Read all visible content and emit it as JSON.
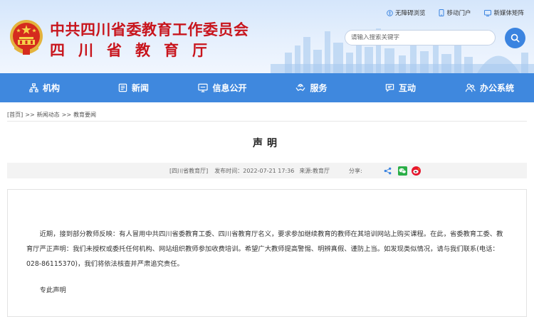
{
  "header": {
    "title_cn": "中共四川省委教育工作委员会",
    "title_sub": "四川省教育厅",
    "top_links": [
      {
        "label": "无障碍浏览",
        "icon": "accessibility-icon"
      },
      {
        "label": "移动门户",
        "icon": "mobile-icon"
      },
      {
        "label": "新媒体矩阵",
        "icon": "media-matrix-icon"
      }
    ],
    "search": {
      "placeholder": "请输入搜索关键字",
      "value": ""
    },
    "colors": {
      "title": "#c8151d",
      "nav": "#3f88de",
      "accent": "#3b84e0"
    }
  },
  "nav": [
    {
      "label": "机构",
      "icon": "org-icon"
    },
    {
      "label": "新闻",
      "icon": "news-icon"
    },
    {
      "label": "信息公开",
      "icon": "info-open-icon"
    },
    {
      "label": "服务",
      "icon": "service-icon"
    },
    {
      "label": "互动",
      "icon": "interaction-icon"
    },
    {
      "label": "办公系统",
      "icon": "office-system-icon"
    }
  ],
  "breadcrumb": [
    "[首页]",
    ">>",
    "新闻动态",
    ">>",
    "教育要闻"
  ],
  "article": {
    "title": "声明",
    "meta": {
      "source_bracket": "[四川省教育厅]",
      "published": "发布时间：2022-07-21 17:36",
      "origin": "来源:教育厅",
      "share_label": "分享:"
    },
    "body": "近期，接到部分教师反映：有人冒用中共四川省委教育工委、四川省教育厅名义，要求参加继续教育的教师在其培训网站上购买课程。在此，省委教育工委、教育厅严正声明：我们未授权或委托任何机构、网站组织教师参加收费培训。希望广大教师提高警惕、明辨真假、谨防上当。如发现类似情况，请与我们联系(电话：028-86115370)，我们将依法核查并严肃追究责任。",
    "closing": "专此声明"
  }
}
